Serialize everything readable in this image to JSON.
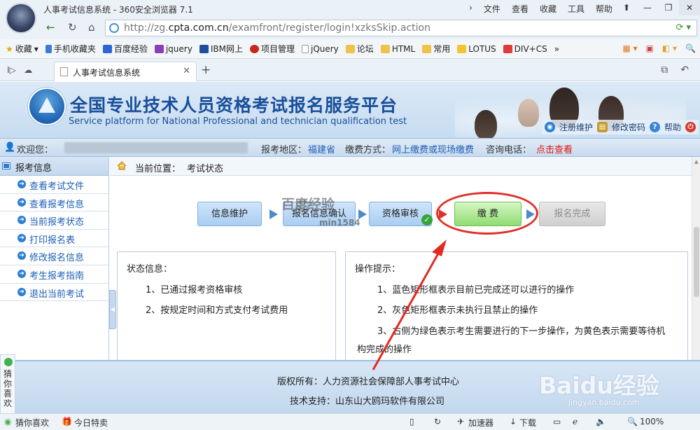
{
  "browser": {
    "window_title": "人事考试信息系统 - 360安全浏览器 7.1",
    "menu": [
      "文件",
      "查看",
      "收藏",
      "工具",
      "帮助"
    ],
    "url_prefix": "http://zg.",
    "url_domain": "cpta.com.cn",
    "url_path": "/examfront/register/login!xzksSkip.action",
    "bookmarks": [
      "收藏",
      "手机收藏夹",
      "百度经验",
      "jquery",
      "IBM网上",
      "项目管理",
      "jQuery",
      "论坛",
      "HTML",
      "常用",
      "LOTUS",
      "DIV+CS"
    ],
    "tab_title": "人事考试信息系统",
    "new_tab": "+"
  },
  "banner": {
    "title": "全国专业技术人员资格考试报名服务平台",
    "subtitle": "Service platform for National Professional and technician qualification test",
    "links": [
      "注册维护",
      "修改密码",
      "帮助"
    ]
  },
  "infobar": {
    "welcome": "欢迎您：",
    "region_label": "报考地区：",
    "region": "福建省",
    "pay_label": "缴费方式：",
    "pay": "网上缴费或现场缴费",
    "consult_label": "咨询电话：",
    "consult_link": "点击查看"
  },
  "sidebar": {
    "header": "报考信息",
    "items": [
      "查看考试文件",
      "查看报考信息",
      "当前报考状态",
      "打印报名表",
      "修改报名信息",
      "考生报考指南",
      "退出当前考试"
    ]
  },
  "breadcrumb": {
    "label": "当前位置：",
    "current": "考试状态"
  },
  "steps": [
    "信息维护",
    "报名信息确认",
    "资格审核",
    "缴 费",
    "报名完成"
  ],
  "watermark": {
    "text": "百度经验",
    "id": "min1584"
  },
  "status_panel": {
    "heading": "状态信息：",
    "lines": [
      "1、已通过报考资格审核",
      "2、按规定时间和方式支付考试费用"
    ]
  },
  "tips_panel": {
    "heading": "操作提示：",
    "lines": [
      "1、蓝色矩形框表示目前已完成还可以进行的操作",
      "2、灰色矩形框表示未执行且禁止的操作",
      "3、右侧为绿色表示考生需要进行的下一步操作，为黄色表示需要等待机",
      "构完成的操作"
    ]
  },
  "footer": {
    "copyright": "版权所有：人力资源社会保障部人事考试中心",
    "tech": "技术支持：山东山大鸥玛软件有限公司"
  },
  "side_guess": "猜你喜欢",
  "baidu_wm": {
    "logo": "Baidu经验",
    "url": "jingyan.baidu.com"
  },
  "statusbar": {
    "guess": "猜你喜欢",
    "today": "今日特卖",
    "speed": "加速器",
    "download": "下载",
    "zoom": "100%"
  },
  "colors": {
    "accent_blue": "#1c5eb5",
    "alert_red": "#e0160f",
    "green_step": "#8fdc71"
  }
}
